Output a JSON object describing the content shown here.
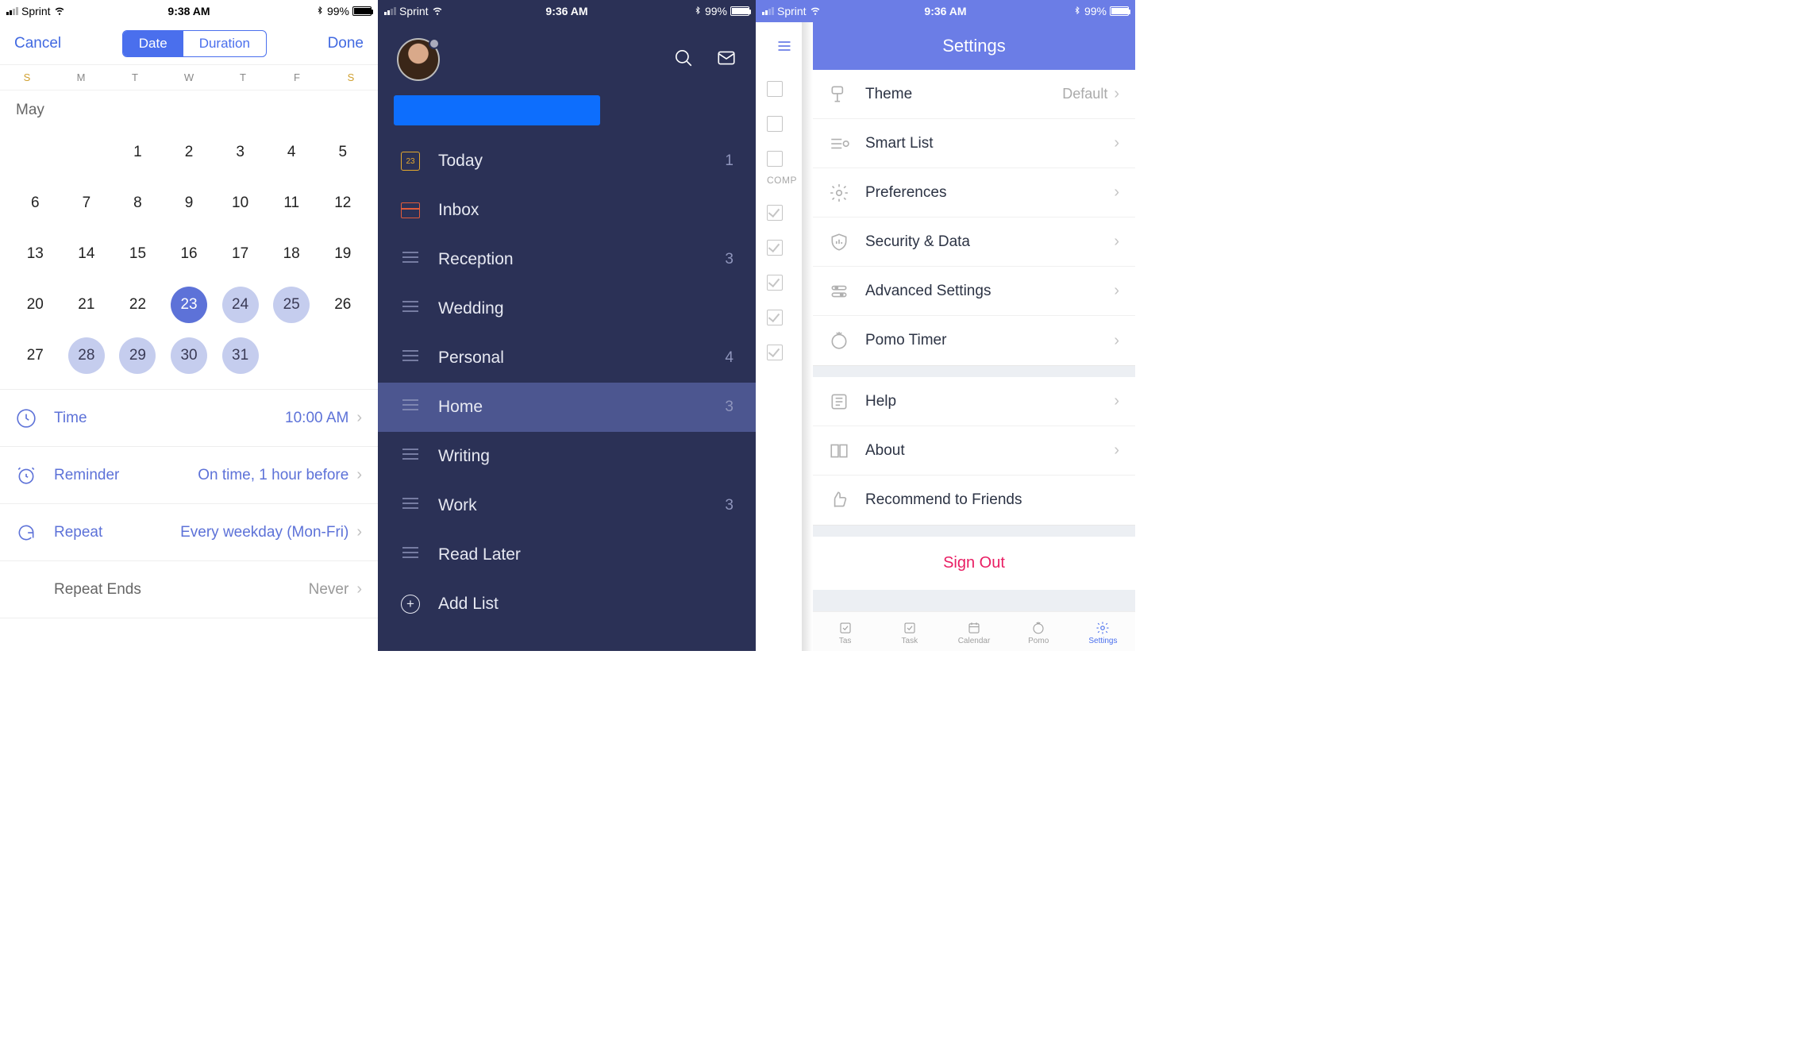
{
  "screen1": {
    "statusbar": {
      "carrier": "Sprint",
      "time": "9:38 AM",
      "battery_pct": "99%"
    },
    "nav": {
      "cancel": "Cancel",
      "done": "Done",
      "date_tab": "Date",
      "duration_tab": "Duration"
    },
    "weekdays": [
      "S",
      "M",
      "T",
      "W",
      "T",
      "F",
      "S"
    ],
    "month": "May",
    "rows": {
      "time": {
        "label": "Time",
        "value": "10:00 AM"
      },
      "reminder": {
        "label": "Reminder",
        "value": "On time, 1 hour before"
      },
      "repeat": {
        "label": "Repeat",
        "value": "Every weekday (Mon-Fri)"
      },
      "repeat_ends": {
        "label": "Repeat Ends",
        "value": "Never"
      }
    }
  },
  "screen2": {
    "statusbar": {
      "carrier": "Sprint",
      "time": "9:36 AM",
      "battery_pct": "99%"
    },
    "items": [
      {
        "label": "Today",
        "count": "1",
        "icon": "today",
        "day": "23"
      },
      {
        "label": "Inbox",
        "count": "",
        "icon": "inbox"
      },
      {
        "label": "Reception",
        "count": "3",
        "icon": "list"
      },
      {
        "label": "Wedding",
        "count": "",
        "icon": "list"
      },
      {
        "label": "Personal",
        "count": "4",
        "icon": "list"
      },
      {
        "label": "Home",
        "count": "3",
        "icon": "list",
        "active": true
      },
      {
        "label": "Writing",
        "count": "",
        "icon": "list"
      },
      {
        "label": "Work",
        "count": "3",
        "icon": "list"
      },
      {
        "label": "Read Later",
        "count": "",
        "icon": "list"
      }
    ],
    "add_list": "Add List"
  },
  "screen3": {
    "statusbar": {
      "carrier": "Sprint",
      "time": "9:36 AM",
      "battery_pct": "99%"
    },
    "completed_label": "COMP",
    "title": "Settings",
    "groups": [
      [
        {
          "label": "Theme",
          "value": "Default",
          "icon": "theme"
        },
        {
          "label": "Smart List",
          "icon": "smartlist"
        },
        {
          "label": "Preferences",
          "icon": "gear"
        },
        {
          "label": "Security & Data",
          "icon": "shield"
        },
        {
          "label": "Advanced Settings",
          "icon": "sliders"
        },
        {
          "label": "Pomo Timer",
          "icon": "pomo"
        }
      ],
      [
        {
          "label": "Help",
          "icon": "help"
        },
        {
          "label": "About",
          "icon": "book"
        },
        {
          "label": "Recommend to Friends",
          "icon": "thumbs",
          "no_chev": true
        }
      ]
    ],
    "signout": "Sign Out",
    "tabs": [
      "Tas",
      "Task",
      "Calendar",
      "Pomo",
      "Settings"
    ]
  }
}
